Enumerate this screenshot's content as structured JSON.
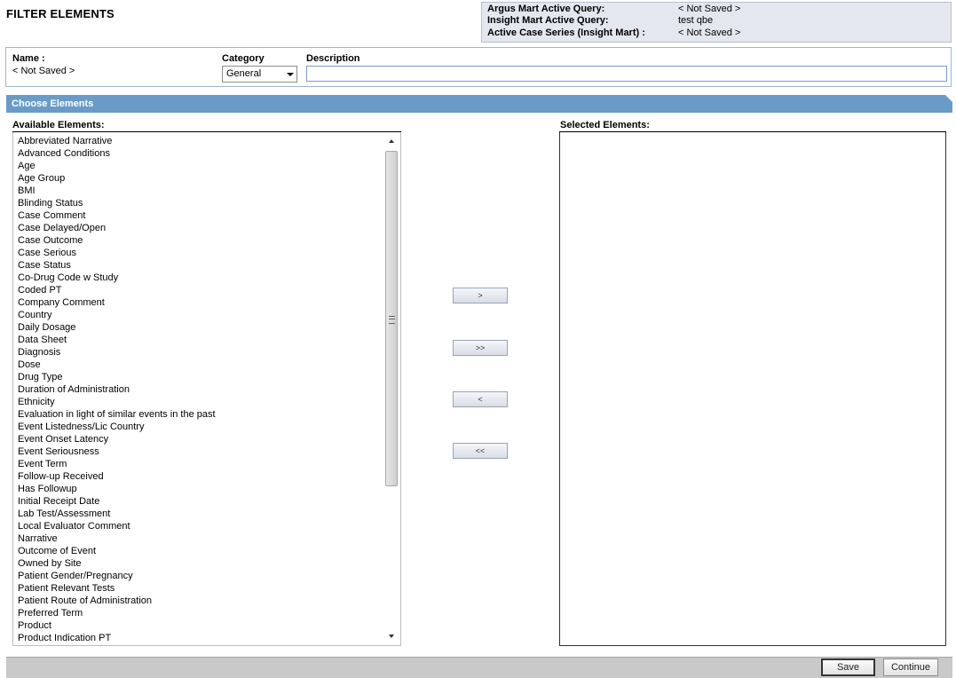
{
  "page": {
    "title": "FILTER ELEMENTS"
  },
  "query_info": [
    {
      "label": "Argus Mart Active Query:",
      "value": "< Not Saved >"
    },
    {
      "label": "Insight Mart Active Query:",
      "value": "test qbe"
    },
    {
      "label": "Active Case Series (Insight Mart) :",
      "value": "< Not Saved >"
    }
  ],
  "filter": {
    "name_label": "Name :",
    "name_value": "< Not Saved >",
    "category_label": "Category",
    "category_value": "General",
    "description_label": "Description",
    "description_value": ""
  },
  "choose": {
    "section_title": "Choose Elements",
    "available_label": "Available Elements:",
    "selected_label": "Selected Elements:",
    "available_items": [
      "Abbreviated Narrative",
      "Advanced Conditions",
      "Age",
      "Age Group",
      "BMI",
      "Blinding Status",
      "Case Comment",
      "Case Delayed/Open",
      "Case Outcome",
      "Case Serious",
      "Case Status",
      "Co-Drug Code w Study",
      "Coded PT",
      "Company Comment",
      "Country",
      "Daily Dosage",
      "Data Sheet",
      "Diagnosis",
      "Dose",
      "Drug Type",
      "Duration of Administration",
      "Ethnicity",
      "Evaluation in light of similar events in the past",
      "Event Listedness/Lic Country",
      "Event Onset Latency",
      "Event Seriousness",
      "Event Term",
      "Follow-up Received",
      "Has Followup",
      "Initial Receipt Date",
      "Lab Test/Assessment",
      "Local Evaluator Comment",
      "Narrative",
      "Outcome of Event",
      "Owned by Site",
      "Patient Gender/Pregnancy",
      "Patient Relevant Tests",
      "Patient Route of Administration",
      "Preferred Term",
      "Product",
      "Product Indication PT"
    ],
    "selected_items": [],
    "buttons": {
      "add": ">",
      "add_all": ">>",
      "remove": "<",
      "remove_all": "<<"
    }
  },
  "footer": {
    "save": "Save",
    "continue": "Continue"
  }
}
